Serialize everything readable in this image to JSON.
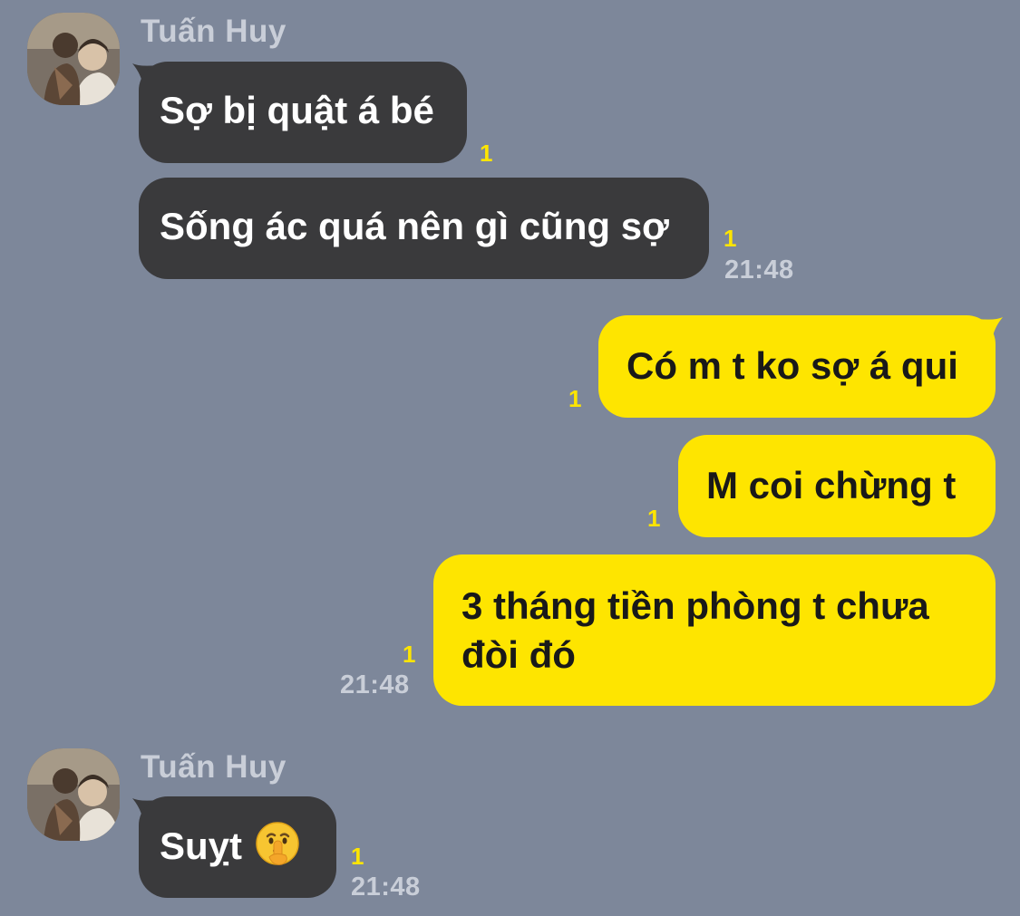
{
  "chat": {
    "group1": {
      "sender": "Tuấn Huy",
      "m1": {
        "text": "Sợ bị quật á bé",
        "unread": "1"
      },
      "m2": {
        "text": "Sống ác quá nên gì cũng sợ",
        "unread": "1",
        "time": "21:48"
      }
    },
    "group2": {
      "m1": {
        "text": "Có m t ko sợ á qui",
        "unread": "1"
      },
      "m2": {
        "text": "M coi chừng t",
        "unread": "1"
      },
      "m3": {
        "line1": "3 tháng tiền phòng t chưa",
        "line2": "đòi đó",
        "unread": "1",
        "time": "21:48"
      }
    },
    "group3": {
      "sender": "Tuấn Huy",
      "m1": {
        "text": "Suỵt",
        "emoji": "shushing-face-emoji",
        "unread": "1",
        "time": "21:48"
      }
    }
  },
  "colors": {
    "background": "#7d879a",
    "incoming_bubble": "#3a3a3c",
    "outgoing_bubble": "#fee500",
    "unread_counter": "#fee500",
    "meta_text": "#c9ced8"
  }
}
